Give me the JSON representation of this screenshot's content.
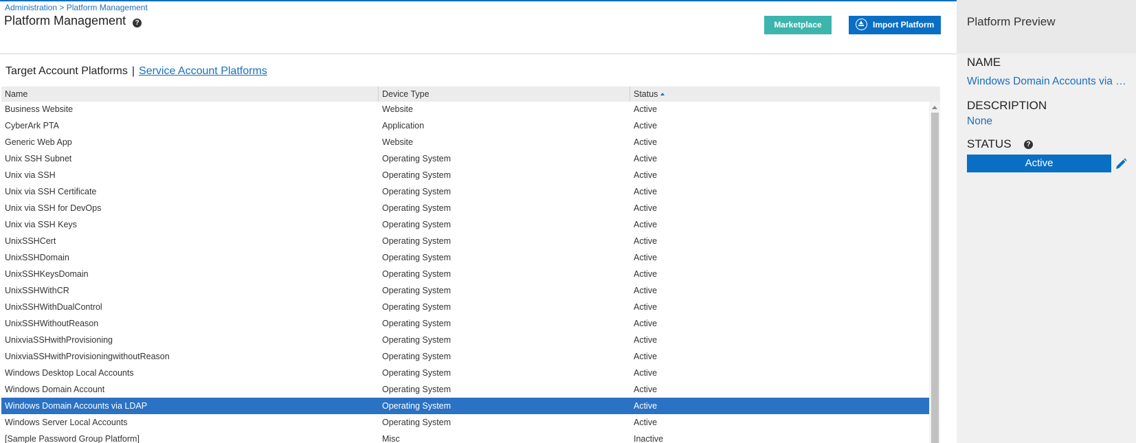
{
  "breadcrumb": {
    "parent": "Administration",
    "separator": " > ",
    "current": "Platform Management"
  },
  "page": {
    "title": "Platform Management"
  },
  "toolbar": {
    "marketplace_label": "Marketplace",
    "import_label": "Import Platform"
  },
  "tabs": {
    "target": "Target Account Platforms",
    "separator": "|",
    "service": "Service Account Platforms"
  },
  "table": {
    "columns": [
      "Name",
      "Device Type",
      "Status"
    ],
    "sort_column": "Status",
    "sort_direction": "ascending",
    "selected_index": 18,
    "rows": [
      {
        "name": "Business Website",
        "device_type": "Website",
        "status": "Active"
      },
      {
        "name": "CyberArk PTA",
        "device_type": "Application",
        "status": "Active"
      },
      {
        "name": "Generic Web App",
        "device_type": "Website",
        "status": "Active"
      },
      {
        "name": "Unix SSH Subnet",
        "device_type": "Operating System",
        "status": "Active"
      },
      {
        "name": "Unix via SSH",
        "device_type": "Operating System",
        "status": "Active"
      },
      {
        "name": "Unix via SSH Certificate",
        "device_type": "Operating System",
        "status": "Active"
      },
      {
        "name": "Unix via SSH for DevOps",
        "device_type": "Operating System",
        "status": "Active"
      },
      {
        "name": "Unix via SSH Keys",
        "device_type": "Operating System",
        "status": "Active"
      },
      {
        "name": "UnixSSHCert",
        "device_type": "Operating System",
        "status": "Active"
      },
      {
        "name": "UnixSSHDomain",
        "device_type": "Operating System",
        "status": "Active"
      },
      {
        "name": "UnixSSHKeysDomain",
        "device_type": "Operating System",
        "status": "Active"
      },
      {
        "name": "UnixSSHWithCR",
        "device_type": "Operating System",
        "status": "Active"
      },
      {
        "name": "UnixSSHWithDualControl",
        "device_type": "Operating System",
        "status": "Active"
      },
      {
        "name": "UnixSSHWithoutReason",
        "device_type": "Operating System",
        "status": "Active"
      },
      {
        "name": "UnixviaSSHwithProvisioning",
        "device_type": "Operating System",
        "status": "Active"
      },
      {
        "name": "UnixviaSSHwithProvisioningwithoutReason",
        "device_type": "Operating System",
        "status": "Active"
      },
      {
        "name": "Windows Desktop Local Accounts",
        "device_type": "Operating System",
        "status": "Active"
      },
      {
        "name": "Windows Domain Account",
        "device_type": "Operating System",
        "status": "Active"
      },
      {
        "name": "Windows Domain Accounts via LDAP",
        "device_type": "Operating System",
        "status": "Active"
      },
      {
        "name": "Windows Server Local Accounts",
        "device_type": "Operating System",
        "status": "Active"
      },
      {
        "name": "[Sample Password Group Platform]",
        "device_type": "Misc",
        "status": "Inactive"
      }
    ]
  },
  "preview": {
    "title": "Platform Preview",
    "name_label": "NAME",
    "name_value": "Windows Domain Accounts via LDAP",
    "description_label": "DESCRIPTION",
    "description_value": "None",
    "status_label": "STATUS",
    "status_value": "Active"
  },
  "icons": {
    "help": "help-circle-icon",
    "import": "upload-circle-icon",
    "sort": "sort-ascending-icon",
    "edit": "pencil-icon"
  },
  "colors": {
    "accent_blue": "#0a6fc4",
    "marketplace_teal": "#3bb5ad",
    "selected_row": "#2a72c3",
    "link_blue": "#1a6fc0"
  }
}
